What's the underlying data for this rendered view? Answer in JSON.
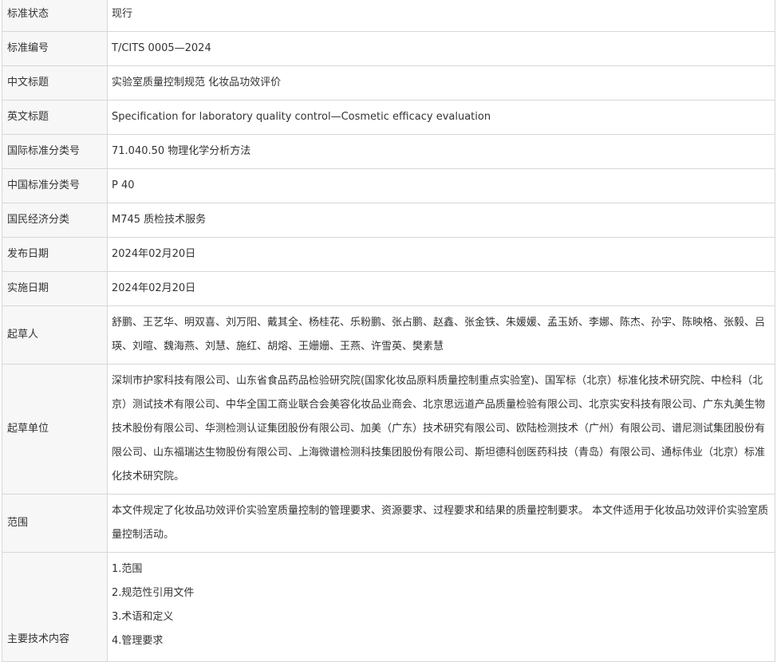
{
  "rows": [
    {
      "label": "标准状态",
      "value": "现行"
    },
    {
      "label": "标准编号",
      "value": "T/CITS 0005—2024"
    },
    {
      "label": "中文标题",
      "value": "实验室质量控制规范 化妆品功效评价"
    },
    {
      "label": "英文标题",
      "value": "Specification for laboratory quality control—Cosmetic efficacy evaluation"
    },
    {
      "label": "国际标准分类号",
      "value": "71.040.50 物理化学分析方法"
    },
    {
      "label": "中国标准分类号",
      "value": "P 40"
    },
    {
      "label": "国民经济分类",
      "value": "M745 质检技术服务"
    },
    {
      "label": "发布日期",
      "value": "2024年02月20日"
    },
    {
      "label": "实施日期",
      "value": "2024年02月20日"
    },
    {
      "label": "起草人",
      "value": "舒鹏、王艺华、明双喜、刘万阳、戴其全、杨桂花、乐粉鹏、张占鹏、赵鑫、张金铁、朱媛媛、孟玉娇、李娜、陈杰、孙宇、陈映格、张毅、吕瑛、刘暄、魏海燕、刘慧、施红、胡熔、王姗姗、王燕、许雪英、樊素慧"
    },
    {
      "label": "起草单位",
      "value": "深圳市护家科技有限公司、山东省食品药品检验研究院(国家化妆品原料质量控制重点实验室)、国军标（北京）标准化技术研究院、中检科（北京）测试技术有限公司、中华全国工商业联合会美容化妆品业商会、北京思远道产品质量检验有限公司、北京实安科技有限公司、广东丸美生物技术股份有限公司、华测检测认证集团股份有限公司、加美（广东）技术研究有限公司、欧陆检测技术（广州）有限公司、谱尼测试集团股份有限公司、山东福瑞达生物股份有限公司、上海微谱检测科技集团股份有限公司、斯坦德科创医药科技（青岛）有限公司、通标伟业（北京）标准化技术研究院。"
    },
    {
      "label": "范围",
      "value": "本文件规定了化妆品功效评价实验室质量控制的管理要求、资源要求、过程要求和结果的质量控制要求。 本文件适用于化妆品功效评价实验室质量控制活动。"
    }
  ],
  "content": {
    "label": "主要技术内容",
    "items": [
      "1.范围",
      "2.规范性引用文件",
      "3.术语和定义",
      "4.管理要求"
    ]
  }
}
